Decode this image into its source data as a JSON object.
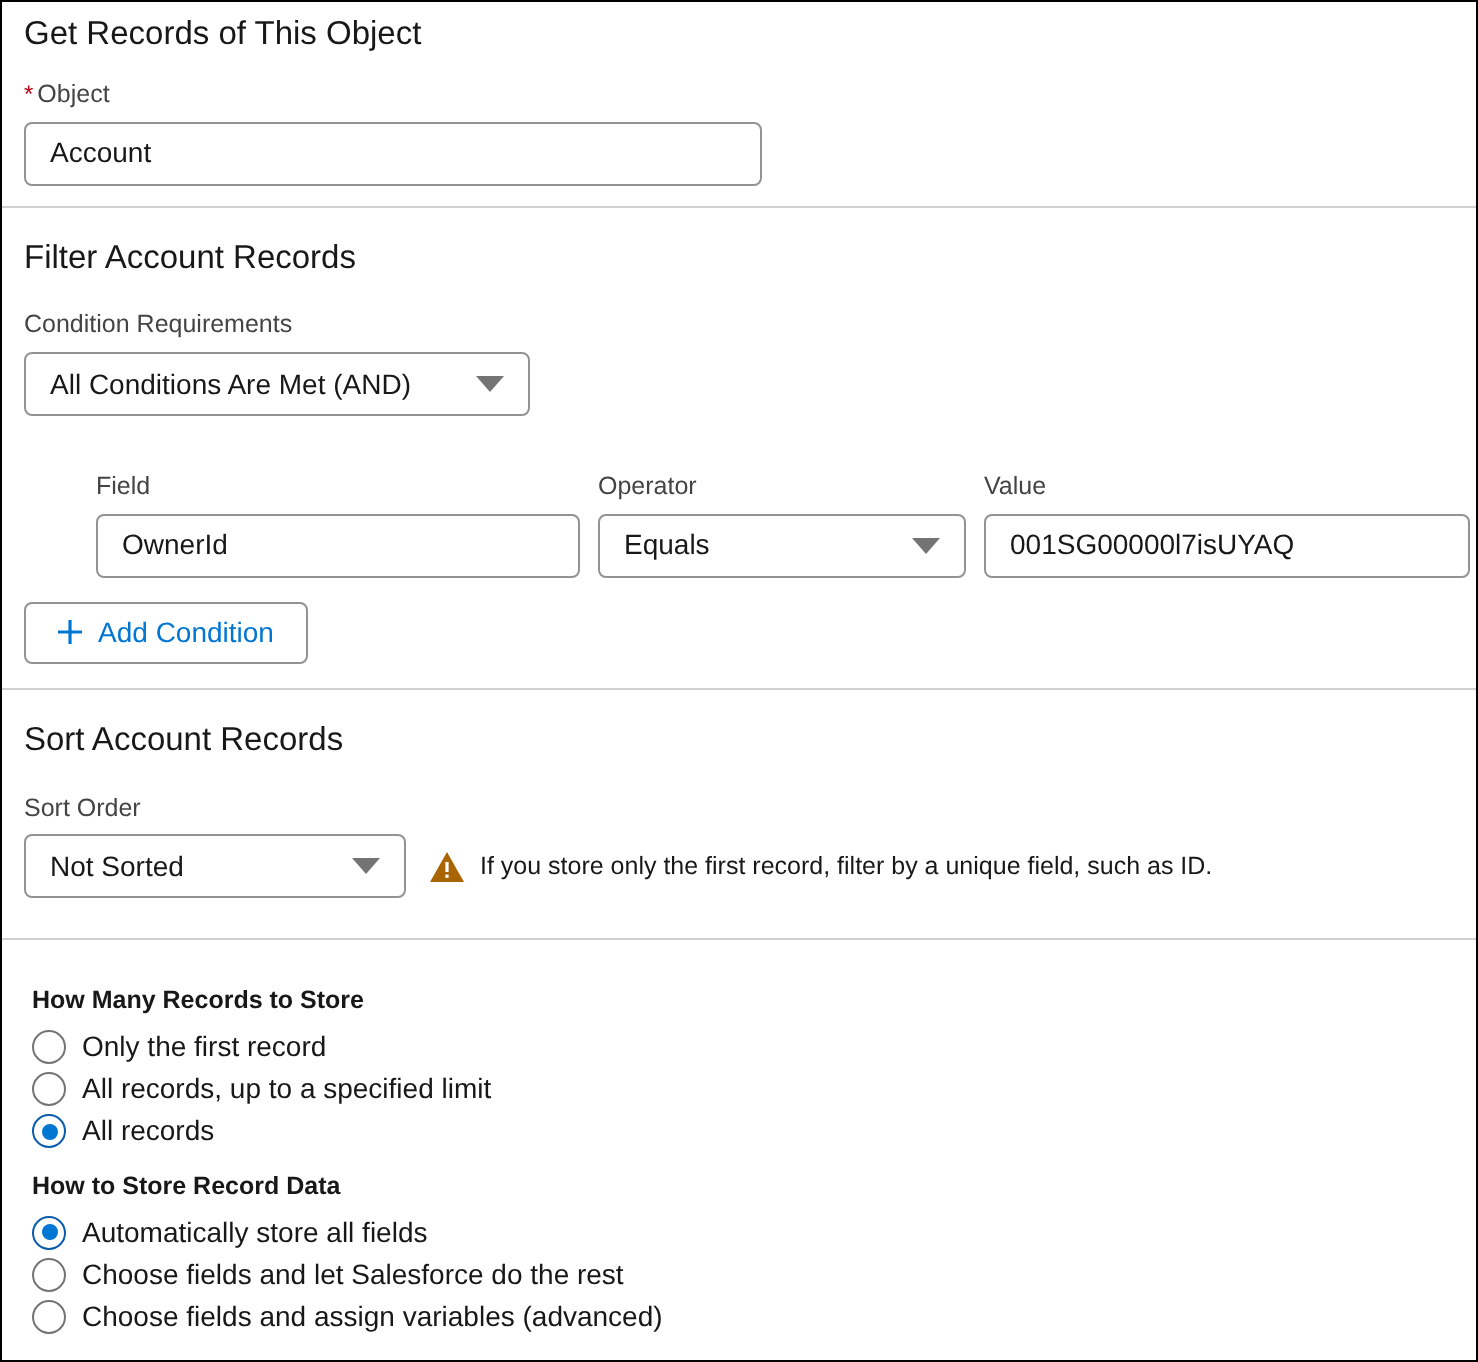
{
  "object_section": {
    "title": "Get Records of This Object",
    "label": "Object",
    "required_mark": "*",
    "value": "Account"
  },
  "filter_section": {
    "title": "Filter Account Records",
    "requirements_label": "Condition Requirements",
    "requirements_value": "All Conditions Are Met (AND)",
    "conditions": [
      {
        "field_label": "Field",
        "field_value": "OwnerId",
        "operator_label": "Operator",
        "operator_value": "Equals",
        "value_label": "Value",
        "value": "001SG00000l7isUYAQ"
      }
    ],
    "add_button": "Add Condition"
  },
  "sort_section": {
    "title": "Sort Account Records",
    "label": "Sort Order",
    "value": "Not Sorted",
    "warning": "If you store only the first record, filter by a unique field, such as ID."
  },
  "radio_groups": [
    {
      "title": "How Many Records to Store",
      "options": [
        {
          "label": "Only the first record",
          "selected": false
        },
        {
          "label": "All records, up to a specified limit",
          "selected": false
        },
        {
          "label": "All records",
          "selected": true
        }
      ]
    },
    {
      "title": "How to Store Record Data",
      "options": [
        {
          "label": "Automatically store all fields",
          "selected": true
        },
        {
          "label": "Choose fields and let Salesforce do the rest",
          "selected": false
        },
        {
          "label": "Choose fields and assign variables (advanced)",
          "selected": false
        }
      ]
    }
  ]
}
